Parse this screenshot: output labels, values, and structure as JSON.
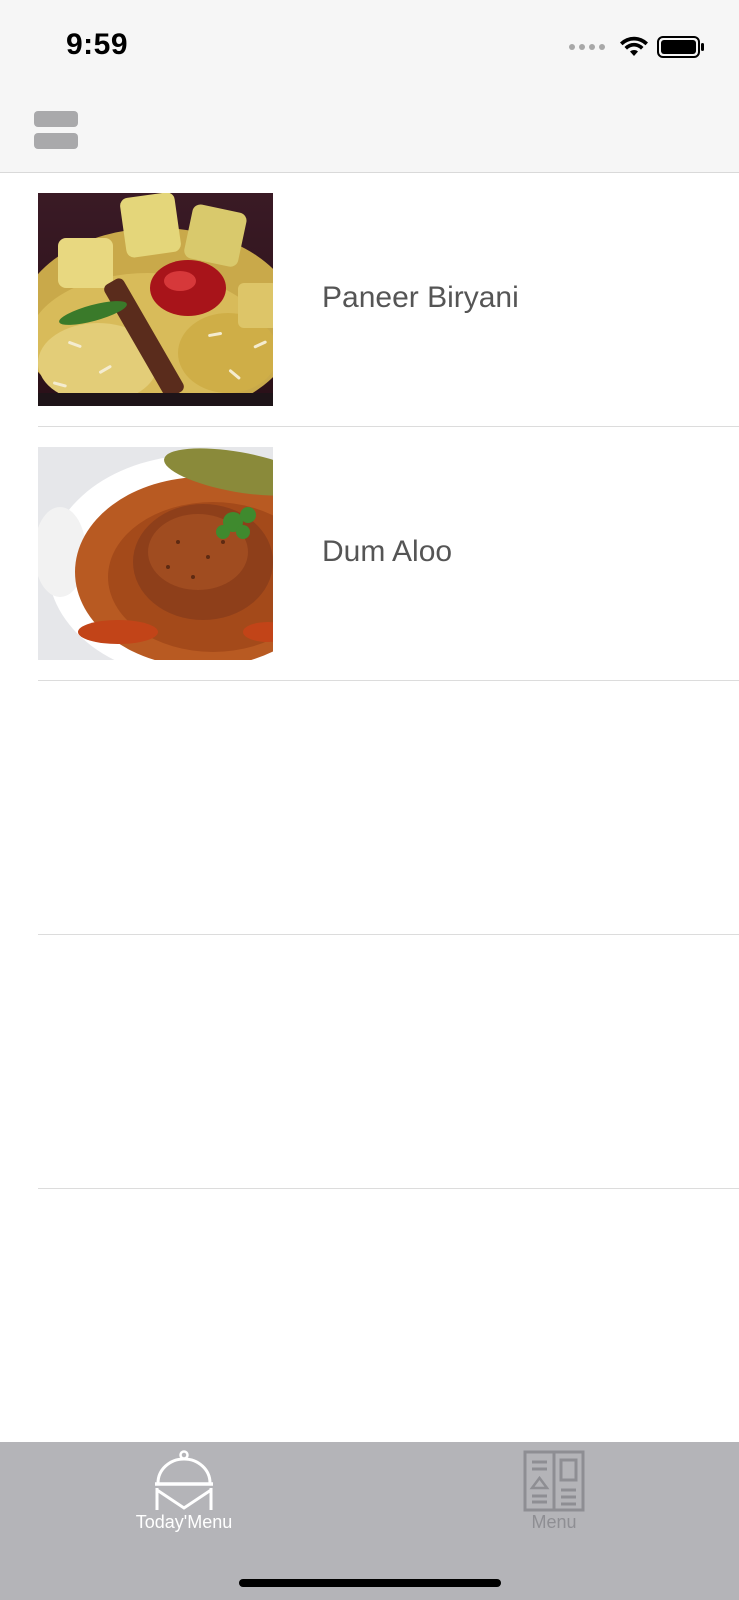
{
  "status_bar": {
    "time": "9:59"
  },
  "header": {
    "menu_icon": "menu-icon"
  },
  "list": {
    "items": [
      {
        "title": "Paneer Biryani",
        "image": "paneer-biryani-photo"
      },
      {
        "title": "Dum Aloo",
        "image": "dum-aloo-photo"
      }
    ]
  },
  "tabbar": {
    "tabs": [
      {
        "label": "Today'Menu",
        "icon": "cloche-icon",
        "active": true
      },
      {
        "label": "Menu",
        "icon": "menu-book-icon",
        "active": false
      }
    ]
  },
  "colors": {
    "header_bg": "#f6f6f6",
    "tabbar_bg": "#b4b4b8",
    "active_tab": "#ffffff",
    "inactive_tab": "#8e8e93",
    "title_text": "#555555"
  }
}
